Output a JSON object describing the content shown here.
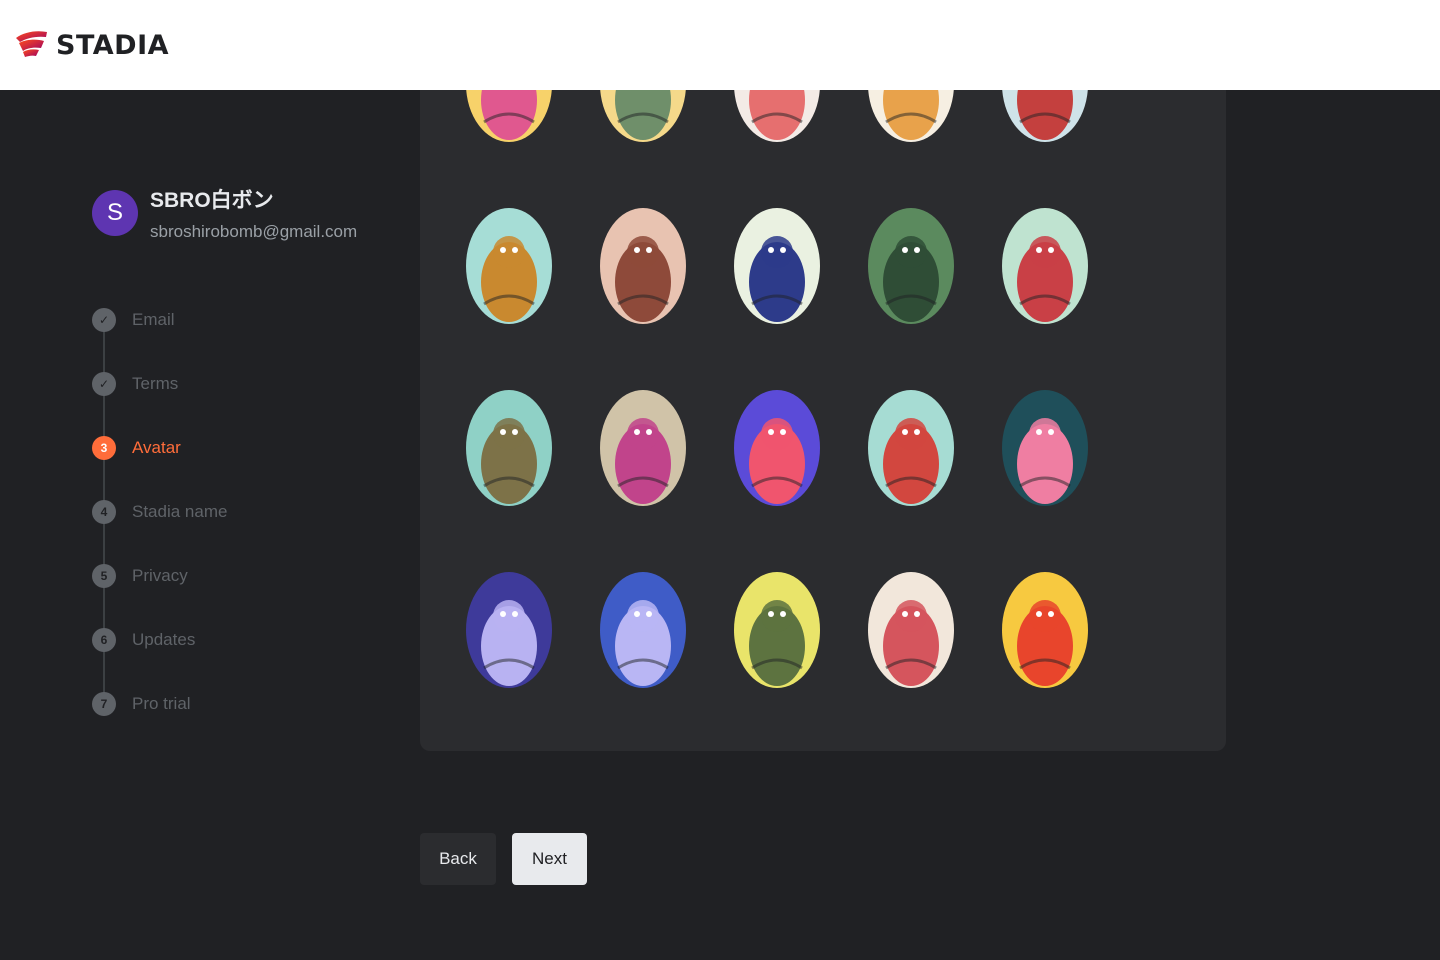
{
  "brand": {
    "logo_text": "STADIA",
    "accent": "#ff4c1d"
  },
  "account": {
    "initial": "S",
    "name": "SBRO白ボン",
    "email": "sbroshirobomb@gmail.com"
  },
  "steps": [
    {
      "label": "Email",
      "marker": "✓",
      "state": "done"
    },
    {
      "label": "Terms",
      "marker": "✓",
      "state": "done"
    },
    {
      "label": "Avatar",
      "marker": "3",
      "state": "active"
    },
    {
      "label": "Stadia name",
      "marker": "4",
      "state": "pending"
    },
    {
      "label": "Privacy",
      "marker": "5",
      "state": "pending"
    },
    {
      "label": "Updates",
      "marker": "6",
      "state": "pending"
    },
    {
      "label": "Pro trial",
      "marker": "7",
      "state": "pending"
    }
  ],
  "avatars": {
    "rows": [
      [
        {
          "name": "avatar-pink-octopus",
          "bg": "#f7d26a",
          "fg": "#e0588f"
        },
        {
          "name": "avatar-armored-warrior",
          "bg": "#f5d98a",
          "fg": "#6f8f6a"
        },
        {
          "name": "avatar-pink-flower",
          "bg": "#f3ebe6",
          "fg": "#e66f6f"
        },
        {
          "name": "avatar-white-bird",
          "bg": "#f6efe2",
          "fg": "#e8a24b"
        },
        {
          "name": "avatar-red-robot-pilot",
          "bg": "#cfe3e9",
          "fg": "#c4403e"
        }
      ],
      [
        {
          "name": "avatar-violinist-girl",
          "bg": "#a6ddd6",
          "fg": "#c9892f"
        },
        {
          "name": "avatar-hatted-bear",
          "bg": "#e8c3b1",
          "fg": "#8e4a3a"
        },
        {
          "name": "avatar-geometric-cubes",
          "bg": "#eaf1e1",
          "fg": "#2d3b8a"
        },
        {
          "name": "avatar-leafy-shield",
          "bg": "#5b8a5e",
          "fg": "#2f4d36"
        },
        {
          "name": "avatar-running-athlete",
          "bg": "#bfe3d0",
          "fg": "#c94046"
        }
      ],
      [
        {
          "name": "avatar-cassette-machine",
          "bg": "#8fd1c6",
          "fg": "#7d7248"
        },
        {
          "name": "avatar-stone-golem",
          "bg": "#d0c3a8",
          "fg": "#c1448b"
        },
        {
          "name": "avatar-red-robot",
          "bg": "#5b4bd8",
          "fg": "#f0556e"
        },
        {
          "name": "avatar-giraffe",
          "bg": "#a6dcd3",
          "fg": "#d2473f"
        },
        {
          "name": "avatar-slot-machine",
          "bg": "#1f4f5a",
          "fg": "#ef7ea2"
        }
      ],
      [
        {
          "name": "avatar-planet-rocket",
          "bg": "#3e3a9a",
          "fg": "#b8b2f2"
        },
        {
          "name": "avatar-astronaut",
          "bg": "#3f5cc7",
          "fg": "#b9b6f4"
        },
        {
          "name": "avatar-mushroom-creature",
          "bg": "#e9e46a",
          "fg": "#5d7340"
        },
        {
          "name": "avatar-polyhedral-die",
          "bg": "#f2e7db",
          "fg": "#d5555d"
        },
        {
          "name": "avatar-fire-spirit",
          "bg": "#f7c940",
          "fg": "#e8452c"
        }
      ]
    ]
  },
  "buttons": {
    "back": "Back",
    "next": "Next"
  }
}
